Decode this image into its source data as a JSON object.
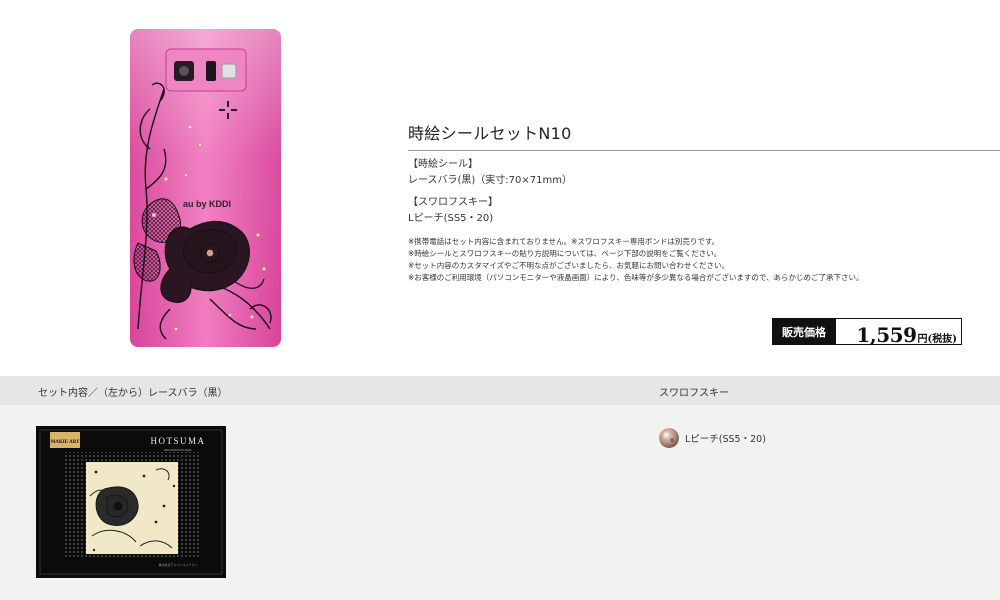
{
  "product": {
    "title": "時絵シールセットN10",
    "sticker_heading": "【時絵シール】",
    "sticker_value": "レースバラ(黒)（実寸:70×71mm）",
    "swarovski_heading": "【スワロフスキー】",
    "swarovski_value": "Lピーチ(SS5・20)",
    "notes": [
      "※携帯電話はセット内容に含まれておりません。※スワロフスキー専用ボンドは別売りです。",
      "※時絵シールとスワロフスキーの貼り方説明については、ページ下部の説明をご覧ください。",
      "※セット内容のカスタマイズやご不明な点がございましたら、お気軽にお問い合わせください。",
      "※お客様のご利用環境（パソコンモニターや液晶画面）により、色味等が多少異なる場合がございますので、あらかじめご了承下さい。"
    ],
    "price_label": "販売価格",
    "price_value": "1,559",
    "price_unit": "円(税抜)"
  },
  "phone_logo": "au by KDDI",
  "sections": {
    "set_contents": "セット内容／（左から）レースバラ（黒）",
    "swarovski": "スワロフスキー"
  },
  "package": {
    "badge": "MAKIE ART",
    "brand": "HOTSUMA",
    "brand_sub": "DECORATION SEAL",
    "footer": "株式会社アドバンスドテクノ"
  },
  "swarovski_items": [
    {
      "label": "Lピーチ(SS5・20)",
      "color": "#c9a093"
    }
  ],
  "colors": {
    "phone_pink": "#e85aa8",
    "band_gray": "#e6e6e6",
    "lower_bg": "#f2f2f2",
    "price_black": "#111111"
  }
}
